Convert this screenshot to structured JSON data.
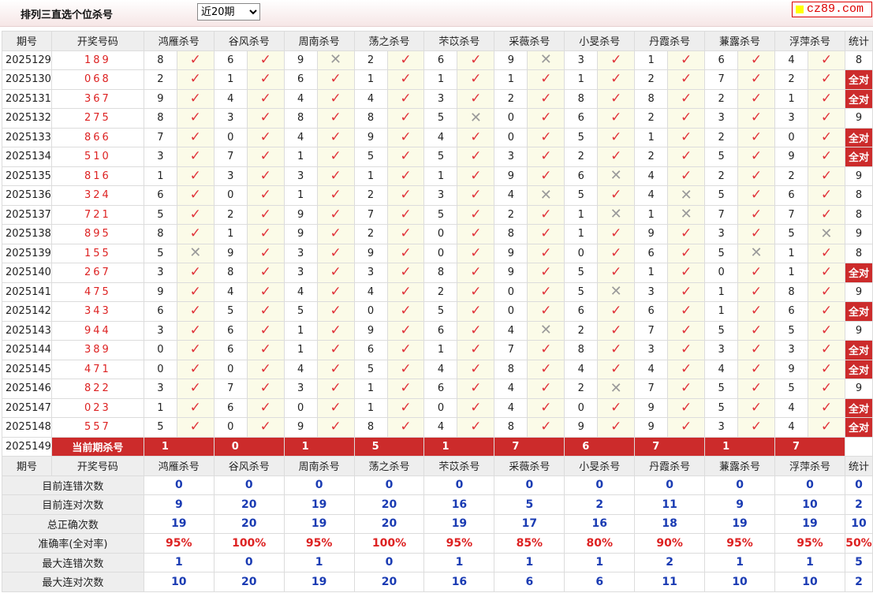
{
  "header": {
    "title": "排列三直选个位杀号",
    "range_selected": "近20期",
    "logo_text": "cz89.com"
  },
  "experts": [
    "鸿雁杀号",
    "谷风杀号",
    "周南杀号",
    "荡之杀号",
    "芣苡杀号",
    "采薇杀号",
    "小旻杀号",
    "丹霞杀号",
    "蒹露杀号",
    "浮萍杀号"
  ],
  "columns": {
    "issue": "期号",
    "draw": "开奖号码",
    "stat": "统计"
  },
  "rows": [
    {
      "issue": "2025129",
      "draw": "189",
      "kills": [
        8,
        6,
        9,
        2,
        6,
        9,
        3,
        1,
        6,
        4
      ],
      "ok": [
        1,
        1,
        0,
        1,
        1,
        0,
        1,
        1,
        1,
        1
      ],
      "stat": "8"
    },
    {
      "issue": "2025130",
      "draw": "068",
      "kills": [
        2,
        1,
        6,
        1,
        1,
        1,
        1,
        2,
        7,
        2
      ],
      "ok": [
        1,
        1,
        1,
        1,
        1,
        1,
        1,
        1,
        1,
        1
      ],
      "stat": "全对"
    },
    {
      "issue": "2025131",
      "draw": "367",
      "kills": [
        9,
        4,
        4,
        4,
        3,
        2,
        8,
        8,
        2,
        1
      ],
      "ok": [
        1,
        1,
        1,
        1,
        1,
        1,
        1,
        1,
        1,
        1
      ],
      "stat": "全对"
    },
    {
      "issue": "2025132",
      "draw": "275",
      "kills": [
        8,
        3,
        8,
        8,
        5,
        0,
        6,
        2,
        3,
        3
      ],
      "ok": [
        1,
        1,
        1,
        1,
        0,
        1,
        1,
        1,
        1,
        1
      ],
      "stat": "9"
    },
    {
      "issue": "2025133",
      "draw": "866",
      "kills": [
        7,
        0,
        4,
        9,
        4,
        0,
        5,
        1,
        2,
        0
      ],
      "ok": [
        1,
        1,
        1,
        1,
        1,
        1,
        1,
        1,
        1,
        1
      ],
      "stat": "全对"
    },
    {
      "issue": "2025134",
      "draw": "510",
      "kills": [
        3,
        7,
        1,
        5,
        5,
        3,
        2,
        2,
        5,
        9
      ],
      "ok": [
        1,
        1,
        1,
        1,
        1,
        1,
        1,
        1,
        1,
        1
      ],
      "stat": "全对"
    },
    {
      "issue": "2025135",
      "draw": "816",
      "kills": [
        1,
        3,
        3,
        1,
        1,
        9,
        6,
        4,
        2,
        2
      ],
      "ok": [
        1,
        1,
        1,
        1,
        1,
        1,
        0,
        1,
        1,
        1
      ],
      "stat": "9"
    },
    {
      "issue": "2025136",
      "draw": "324",
      "kills": [
        6,
        0,
        1,
        2,
        3,
        4,
        5,
        4,
        5,
        6
      ],
      "ok": [
        1,
        1,
        1,
        1,
        1,
        0,
        1,
        0,
        1,
        1
      ],
      "stat": "8"
    },
    {
      "issue": "2025137",
      "draw": "721",
      "kills": [
        5,
        2,
        9,
        7,
        5,
        2,
        1,
        1,
        7,
        7
      ],
      "ok": [
        1,
        1,
        1,
        1,
        1,
        1,
        0,
        0,
        1,
        1
      ],
      "stat": "8"
    },
    {
      "issue": "2025138",
      "draw": "895",
      "kills": [
        8,
        1,
        9,
        2,
        0,
        8,
        1,
        9,
        3,
        5
      ],
      "ok": [
        1,
        1,
        1,
        1,
        1,
        1,
        1,
        1,
        1,
        0
      ],
      "stat": "9"
    },
    {
      "issue": "2025139",
      "draw": "155",
      "kills": [
        5,
        9,
        3,
        9,
        0,
        9,
        0,
        6,
        5,
        1
      ],
      "ok": [
        0,
        1,
        1,
        1,
        1,
        1,
        1,
        1,
        0,
        1
      ],
      "stat": "8"
    },
    {
      "issue": "2025140",
      "draw": "267",
      "kills": [
        3,
        8,
        3,
        3,
        8,
        9,
        5,
        1,
        0,
        1
      ],
      "ok": [
        1,
        1,
        1,
        1,
        1,
        1,
        1,
        1,
        1,
        1
      ],
      "stat": "全对"
    },
    {
      "issue": "2025141",
      "draw": "475",
      "kills": [
        9,
        4,
        4,
        4,
        2,
        0,
        5,
        3,
        1,
        8
      ],
      "ok": [
        1,
        1,
        1,
        1,
        1,
        1,
        0,
        1,
        1,
        1
      ],
      "stat": "9"
    },
    {
      "issue": "2025142",
      "draw": "343",
      "kills": [
        6,
        5,
        5,
        0,
        5,
        0,
        6,
        6,
        1,
        6
      ],
      "ok": [
        1,
        1,
        1,
        1,
        1,
        1,
        1,
        1,
        1,
        1
      ],
      "stat": "全对"
    },
    {
      "issue": "2025143",
      "draw": "944",
      "kills": [
        3,
        6,
        1,
        9,
        6,
        4,
        2,
        7,
        5,
        5
      ],
      "ok": [
        1,
        1,
        1,
        1,
        1,
        0,
        1,
        1,
        1,
        1
      ],
      "stat": "9"
    },
    {
      "issue": "2025144",
      "draw": "389",
      "kills": [
        0,
        6,
        1,
        6,
        1,
        7,
        8,
        3,
        3,
        3
      ],
      "ok": [
        1,
        1,
        1,
        1,
        1,
        1,
        1,
        1,
        1,
        1
      ],
      "stat": "全对"
    },
    {
      "issue": "2025145",
      "draw": "471",
      "kills": [
        0,
        0,
        4,
        5,
        4,
        8,
        4,
        4,
        4,
        9
      ],
      "ok": [
        1,
        1,
        1,
        1,
        1,
        1,
        1,
        1,
        1,
        1
      ],
      "stat": "全对"
    },
    {
      "issue": "2025146",
      "draw": "822",
      "kills": [
        3,
        7,
        3,
        1,
        6,
        4,
        2,
        7,
        5,
        5
      ],
      "ok": [
        1,
        1,
        1,
        1,
        1,
        1,
        0,
        1,
        1,
        1
      ],
      "stat": "9"
    },
    {
      "issue": "2025147",
      "draw": "023",
      "kills": [
        1,
        6,
        0,
        1,
        0,
        4,
        0,
        9,
        5,
        4
      ],
      "ok": [
        1,
        1,
        1,
        1,
        1,
        1,
        1,
        1,
        1,
        1
      ],
      "stat": "全对"
    },
    {
      "issue": "2025148",
      "draw": "557",
      "kills": [
        5,
        0,
        9,
        8,
        4,
        8,
        9,
        9,
        3,
        4
      ],
      "ok": [
        1,
        1,
        1,
        1,
        1,
        1,
        1,
        1,
        1,
        1
      ],
      "stat": "全对"
    }
  ],
  "current": {
    "issue": "2025149",
    "label": "当前期杀号",
    "kills": [
      1,
      0,
      1,
      5,
      1,
      7,
      6,
      7,
      1,
      7
    ]
  },
  "stats": [
    {
      "label": "目前连错次数",
      "values": [
        "0",
        "0",
        "0",
        "0",
        "0",
        "0",
        "0",
        "0",
        "0",
        "0",
        "0"
      ],
      "red": false
    },
    {
      "label": "目前连对次数",
      "values": [
        "9",
        "20",
        "19",
        "20",
        "16",
        "5",
        "2",
        "11",
        "9",
        "10",
        "2"
      ],
      "red": false
    },
    {
      "label": "总正确次数",
      "values": [
        "19",
        "20",
        "19",
        "20",
        "19",
        "17",
        "16",
        "18",
        "19",
        "19",
        "10"
      ],
      "red": false
    },
    {
      "label": "准确率(全对率)",
      "values": [
        "95%",
        "100%",
        "95%",
        "100%",
        "95%",
        "85%",
        "80%",
        "90%",
        "95%",
        "95%",
        "50%"
      ],
      "red": true
    },
    {
      "label": "最大连错次数",
      "values": [
        "1",
        "0",
        "1",
        "0",
        "1",
        "1",
        "1",
        "2",
        "1",
        "1",
        "5"
      ],
      "red": false
    },
    {
      "label": "最大连对次数",
      "values": [
        "10",
        "20",
        "19",
        "20",
        "16",
        "6",
        "6",
        "11",
        "10",
        "10",
        "2"
      ],
      "red": false
    }
  ]
}
